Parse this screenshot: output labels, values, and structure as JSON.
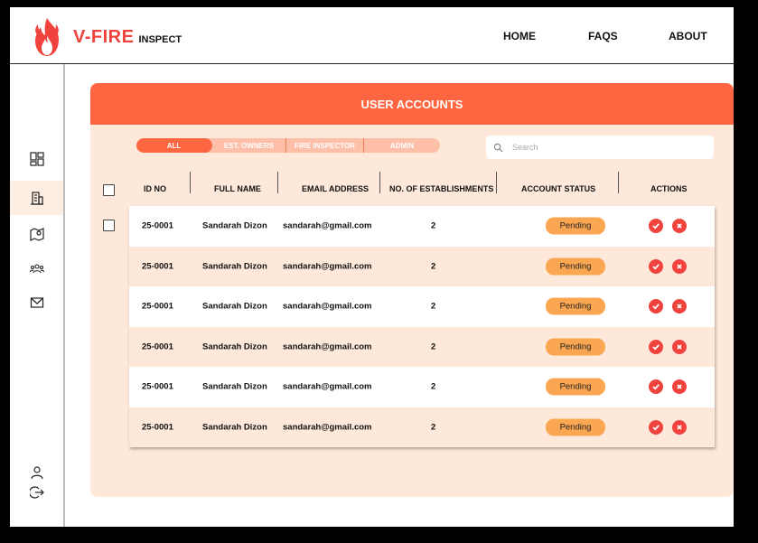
{
  "brand": {
    "name": "V-FIRE",
    "sub": "INSPECT"
  },
  "nav": [
    {
      "label": "HOME"
    },
    {
      "label": "FAQS"
    },
    {
      "label": "ABOUT"
    }
  ],
  "sidebar": {
    "items": [
      {
        "icon": "dashboard-icon"
      },
      {
        "icon": "building-icon",
        "active": true
      },
      {
        "icon": "map-pin-icon"
      },
      {
        "icon": "users-icon"
      },
      {
        "icon": "mail-icon"
      }
    ],
    "bottom": [
      {
        "icon": "user-icon"
      },
      {
        "icon": "logout-icon"
      }
    ]
  },
  "panel": {
    "title": "USER ACCOUNTS"
  },
  "tabs": [
    {
      "label": "ALL",
      "active": true
    },
    {
      "label": "EST. OWNERS"
    },
    {
      "label": "FIRE INSPECTOR"
    },
    {
      "label": "ADMIN"
    }
  ],
  "search": {
    "placeholder": "Search"
  },
  "table": {
    "columns": [
      "ID NO",
      "FULL NAME",
      "EMAIL ADDRESS",
      "NO. OF ESTABLISHMENTS",
      "ACCOUNT STATUS",
      "ACTIONS"
    ],
    "rows": [
      {
        "id": "25-0001",
        "name": "Sandarah Dizon",
        "email": "sandarah@gmail.com",
        "count": "2",
        "status": "Pending"
      },
      {
        "id": "25-0001",
        "name": "Sandarah Dizon",
        "email": "sandarah@gmail.com",
        "count": "2",
        "status": "Pending"
      },
      {
        "id": "25-0001",
        "name": "Sandarah Dizon",
        "email": "sandarah@gmail.com",
        "count": "2",
        "status": "Pending"
      },
      {
        "id": "25-0001",
        "name": "Sandarah Dizon",
        "email": "sandarah@gmail.com",
        "count": "2",
        "status": "Pending"
      },
      {
        "id": "25-0001",
        "name": "Sandarah Dizon",
        "email": "sandarah@gmail.com",
        "count": "2",
        "status": "Pending"
      },
      {
        "id": "25-0001",
        "name": "Sandarah Dizon",
        "email": "sandarah@gmail.com",
        "count": "2",
        "status": "Pending"
      }
    ]
  },
  "colors": {
    "accent": "#fe6541",
    "brand_red": "#f0433d",
    "panel_bg": "#fde8da",
    "status_pending": "#fba651"
  }
}
